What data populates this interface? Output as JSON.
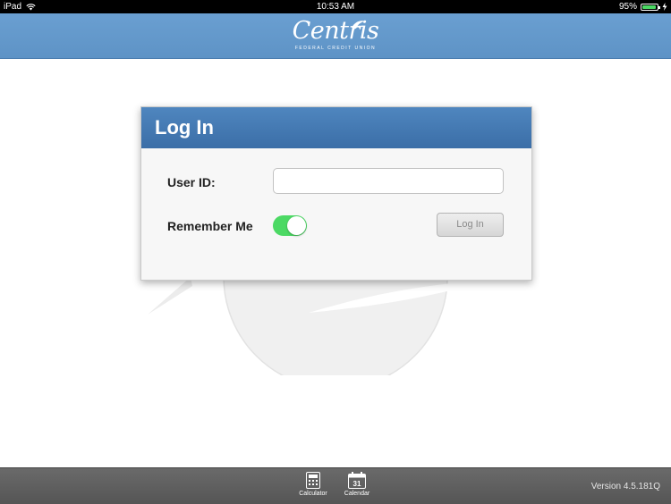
{
  "status_bar": {
    "device": "iPad",
    "time": "10:53 AM",
    "battery_percent": "95%",
    "battery_level": 0.95,
    "icons": [
      "wifi-icon",
      "battery-icon",
      "charging-icon"
    ]
  },
  "header": {
    "logo_name": "Centris",
    "logo_subtitle": "FEDERAL CREDIT UNION"
  },
  "login": {
    "title": "Log In",
    "user_id_label": "User ID:",
    "user_id_value": "",
    "user_id_placeholder": "",
    "remember_label": "Remember Me",
    "remember_on": true,
    "submit_label": "Log In"
  },
  "toolbar": {
    "items": [
      {
        "label": "Calculator",
        "icon": "calculator-icon"
      },
      {
        "label": "Calendar",
        "icon": "calendar-icon",
        "icon_text": "31"
      }
    ],
    "version": "Version 4.5.181Q"
  },
  "colors": {
    "header": "#6a9fd1",
    "card_header": "#4f86bf",
    "toggle_on": "#4cd964",
    "toolbar": "#5e5e5e"
  }
}
